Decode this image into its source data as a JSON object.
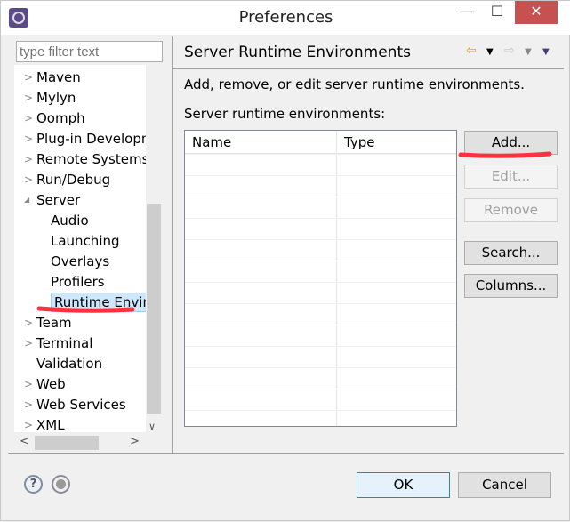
{
  "window": {
    "title": "Preferences",
    "minimize": "—",
    "maximize": "☐",
    "close": "✕"
  },
  "filter": {
    "placeholder": "type filter text"
  },
  "tree": [
    {
      "label": "Maven",
      "level": 0,
      "exp": ">"
    },
    {
      "label": "Mylyn",
      "level": 0,
      "exp": ">"
    },
    {
      "label": "Oomph",
      "level": 0,
      "exp": ">"
    },
    {
      "label": "Plug-in Development",
      "level": 0,
      "exp": ">"
    },
    {
      "label": "Remote Systems",
      "level": 0,
      "exp": ">"
    },
    {
      "label": "Run/Debug",
      "level": 0,
      "exp": ">"
    },
    {
      "label": "Server",
      "level": 0,
      "exp": "◢"
    },
    {
      "label": "Audio",
      "level": 1,
      "exp": ""
    },
    {
      "label": "Launching",
      "level": 1,
      "exp": ""
    },
    {
      "label": "Overlays",
      "level": 1,
      "exp": ""
    },
    {
      "label": "Profilers",
      "level": 1,
      "exp": ""
    },
    {
      "label": "Runtime Environments",
      "level": 1,
      "exp": "",
      "selected": true
    },
    {
      "label": "Team",
      "level": 0,
      "exp": ">"
    },
    {
      "label": "Terminal",
      "level": 0,
      "exp": ">"
    },
    {
      "label": "Validation",
      "level": 0,
      "exp": ""
    },
    {
      "label": "Web",
      "level": 0,
      "exp": ">"
    },
    {
      "label": "Web Services",
      "level": 0,
      "exp": ">"
    },
    {
      "label": "XML",
      "level": 0,
      "exp": ">"
    }
  ],
  "page": {
    "title": "Server Runtime Environments",
    "description": "Add, remove, or edit server runtime environments.",
    "table_label": "Server runtime environments:",
    "columns": [
      "Name",
      "Type"
    ],
    "rows": []
  },
  "buttons": {
    "add": "Add...",
    "edit": "Edit...",
    "remove": "Remove",
    "search": "Search...",
    "columns": "Columns..."
  },
  "footer": {
    "help": "?",
    "ok": "OK",
    "cancel": "Cancel"
  },
  "colors": {
    "annotation": "#ff3040",
    "selection": "#cce8ff",
    "close": "#c75050"
  }
}
